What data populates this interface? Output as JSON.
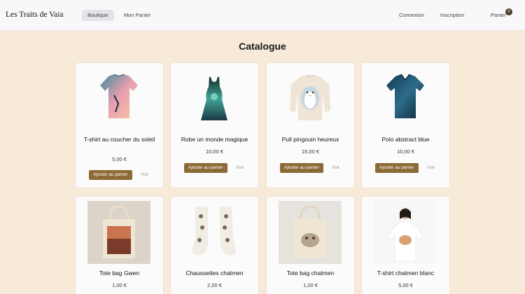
{
  "brand": "Les Traits de Vaia",
  "nav": {
    "boutique": "Boutique",
    "mon_panier": "Mon Panier",
    "connexion": "Connexion",
    "inscription": "Inscription",
    "panier": "Panier",
    "cart_count": "0"
  },
  "page_title": "Catalogue",
  "products": [
    {
      "name": "T-shirt au coucher du soleil",
      "price": "5,00 €",
      "add": "Ajouter au panier",
      "view": "Voir"
    },
    {
      "name": "Robe un monde magique",
      "price": "10,00 €",
      "add": "Ajouter au panier",
      "view": "Voir"
    },
    {
      "name": "Pull pingouin heureux",
      "price": "15,00 €",
      "add": "Ajouter au panier",
      "view": "Voir"
    },
    {
      "name": "Polo abstract blue",
      "price": "10,00 €",
      "add": "Ajouter au panier",
      "view": "Voir"
    },
    {
      "name": "Tote bag Gwen",
      "price": "1,00 €"
    },
    {
      "name": "Chaussettes chatmen",
      "price": "2,00 €"
    },
    {
      "name": "Tote bag chatmen",
      "price": "1,00 €"
    },
    {
      "name": "T-shirt chatmen blanc",
      "price": "5,00 €"
    }
  ]
}
